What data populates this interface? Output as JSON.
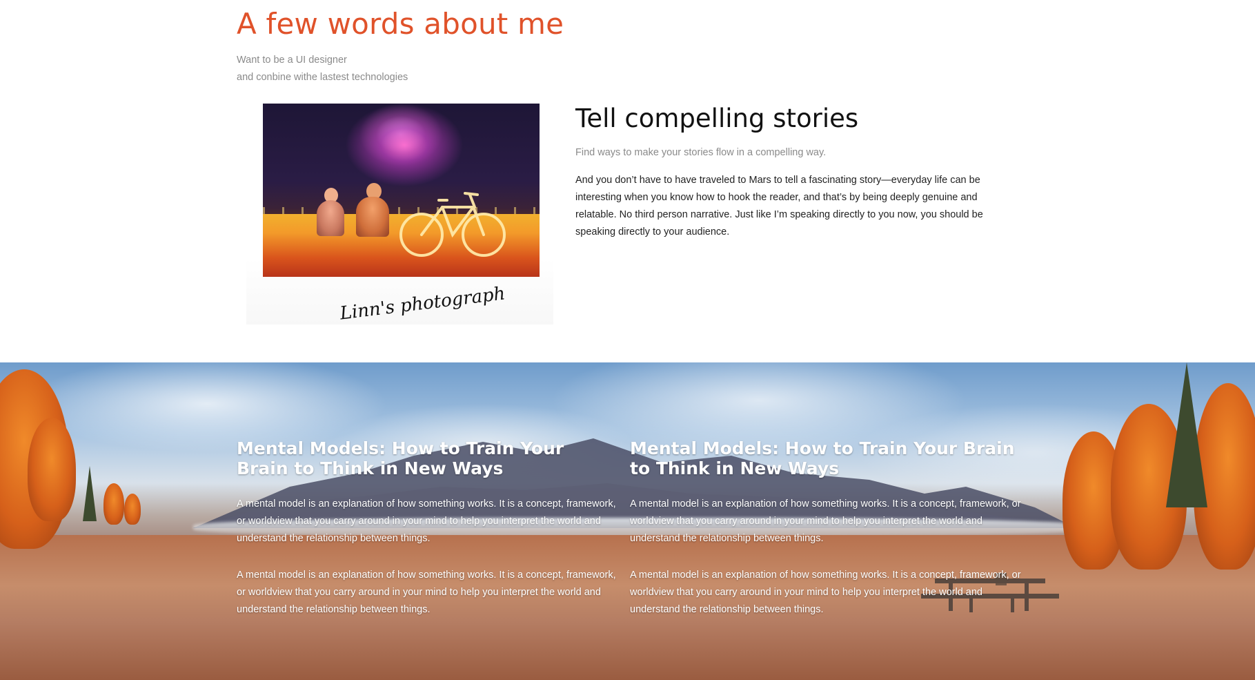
{
  "about": {
    "title": "A few words about me",
    "subtitle_lines": [
      "Want to be a UI designer",
      "and conbine withe lastest technologies"
    ],
    "photo": {
      "signature": "Linn's photograph"
    },
    "story": {
      "title": "Tell compelling stories",
      "subtitle": "Find ways to make your stories flow in a compelling way.",
      "body": "And you don’t have to have traveled to Mars to tell a fascinating story—everyday life can be interesting when you know how to hook the reader, and that’s by being deeply genuine and relatable. No third person narrative. Just like I’m speaking directly to you now, you should be speaking directly to your audience."
    }
  },
  "banner": {
    "articles": [
      {
        "title": "Mental Models: How to Train Your Brain to Think in New Ways",
        "paragraphs": [
          "A mental model is an explanation of how something works. It is a concept, framework, or worldview that you carry around in your mind to help you interpret the world and understand the relationship between things.",
          "A mental model is an explanation of how something works. It is a concept, framework, or worldview that you carry around in your mind to help you interpret the world and understand the relationship between things."
        ]
      },
      {
        "title": "Mental Models: How to Train Your Brain to Think in New Ways",
        "paragraphs": [
          "A mental model is an explanation of how something works. It is a concept, framework, or worldview that you carry around in your mind to help you interpret the world and understand the relationship between things.",
          "A mental model is an explanation of how something works. It is a concept, framework, or worldview that you carry around in your mind to help you interpret the world and understand the relationship between things."
        ]
      }
    ]
  },
  "colors": {
    "accent": "#e0522a",
    "muted_text": "#8a8a8a",
    "body_text": "#222222"
  }
}
